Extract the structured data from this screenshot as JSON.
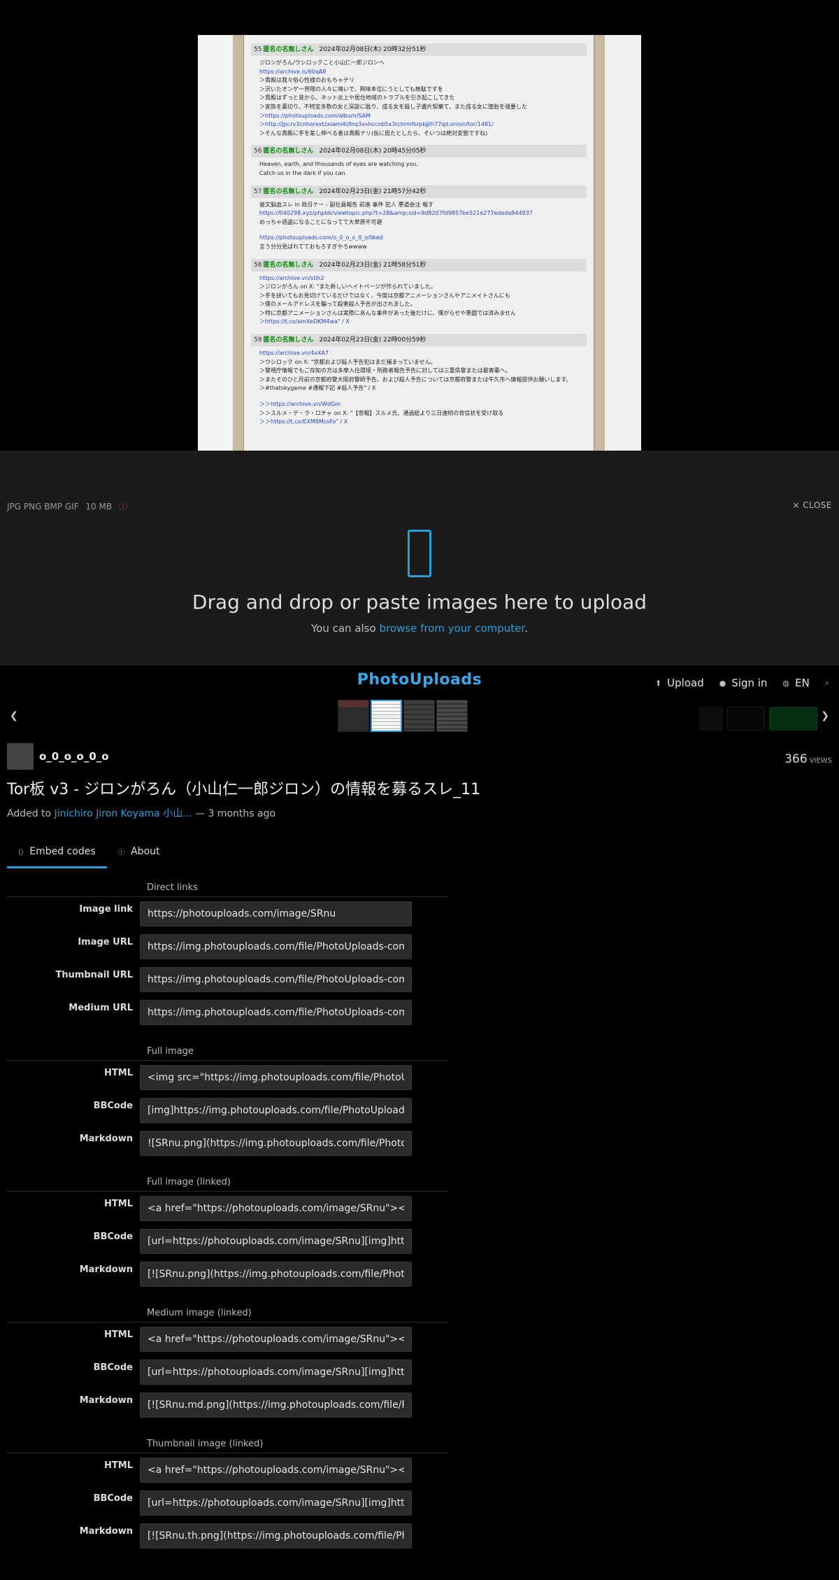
{
  "viewer": {
    "posts": [
      {
        "num": "55",
        "name": "匿名の名無しさん",
        "date": "2024年02月08日(木) 20時32分51秒",
        "lines": [
          {
            "t": "ジロンがろん/ウシロックこと小山仁一郎ジロンへ"
          },
          {
            "t": "https://archive.is/60qA8",
            "link": true
          },
          {
            "t": "＞貴殿は我々俗心性様のおもちゃテリ"
          },
          {
            "t": "＞沢いたオンゲー界隈の人々に嗅いで、興味本位にうとしても無駄ですを"
          },
          {
            "t": "＞貴殿はずっと昔から、ネット炎上や居住地域のトラブルを引き起こしてきた"
          },
          {
            "t": "＞家族を裏切り、不特定多数の女と深談に耽り、成る女を殺し子遺片契棄て、また成る女に堕胎を強要した"
          },
          {
            "t": "＞https://photouploads.com/album/SAM",
            "link": true
          },
          {
            "t": "＞http://jpcrv3cnhorxxtzxiami4ijfnq3xvhccob5x3rchrmfsrpbjjlh77qd.onion/tor/1481/",
            "link": true
          },
          {
            "t": "＞そんな貴殿に手を差し伸べる者は貴殿ナリ(仮に居たとしたら、そいつは絶対変態ですね)"
          }
        ]
      },
      {
        "num": "56",
        "name": "匿名の名無しさん",
        "date": "2024年02月08日(木) 20時45分05秒",
        "lines": [
          {
            "t": "Heaven, earth, and thousands of eyes are watching you."
          },
          {
            "t": "Catch us in the dark if you can."
          }
        ]
      },
      {
        "num": "57",
        "name": "匿名の名無しさん",
        "date": "2024年02月23日(金) 21時57分42秒",
        "lines": [
          {
            "t": "歯文脳血スレ in 政日ケー - 副社員報告 前進 事件 犯人 悪道会注 報す"
          },
          {
            "t": "https://040298.xyz/phpbb/viewtopic.php?t=28&amp;sid=9d8207fd9857be521e277ededa944937",
            "link": true
          },
          {
            "t": "めっちゃ逃盗になることになってて大草原不可避"
          },
          {
            "t": "",
            "gap": true
          },
          {
            "t": "https://photouploads.com/o_0_o_o_0_o/liked",
            "link": true
          },
          {
            "t": "言う分分見ばれてておもろすぎやろwwww"
          }
        ]
      },
      {
        "num": "58",
        "name": "匿名の名無しさん",
        "date": "2024年02月23日(金) 21時58分51秒",
        "lines": [
          {
            "t": "https://archive.vn/stih2",
            "link": true
          },
          {
            "t": "＞ジロンがろん on X: \"また新しいヘイトページが作られていました。"
          },
          {
            "t": "＞手を挟いてもお見切けているだけではなく、今度は京都アニメーションさんやアニメイトさんにも"
          },
          {
            "t": "＞僕のメールアドレスを騙って殺害殺人予告が出されました。"
          },
          {
            "t": "＞特に京都アニメーションさんは実際にあんな事件があった後だけに、僕がらせや悪戯では済みません"
          },
          {
            "t": "＞https://t.co/amXeDKM4wa\" / X",
            "link": true
          }
        ]
      },
      {
        "num": "59",
        "name": "匿名の名無しさん",
        "date": "2024年02月23日(金) 22時00分59秒",
        "lines": [
          {
            "t": "https://archive.vn/4xXA7",
            "link": true
          },
          {
            "t": "＞ウシロック on X: \"京都および殺人予告犯はまだ捕まっていません。"
          },
          {
            "t": "＞警視庁情報でもご存知の方は多摩入住環境・刑務者報告予告に対しては三重県警または最寄署へ。"
          },
          {
            "t": "＞またそのひと月前の京都府警大阪府警師予告、および殺人予告については京都府警または牛久市へ情報提供お願いします。"
          },
          {
            "t": "＞#thatskygame #通報下記 #殺人予告\" / X"
          },
          {
            "t": "",
            "gap": true
          },
          {
            "t": "＞＞https://archive.vn/WdGm",
            "link": true
          },
          {
            "t": "＞＞スルメ・デ・ラ・ロチャ on X: \"【悲報】スルメ氏、通過総より三日連続の背信状を受け取る"
          },
          {
            "t": "＞＞https://t.co/EXM8MssFo\" / X",
            "link": true
          }
        ]
      }
    ]
  },
  "dropzone": {
    "formats": "JPG PNG BMP GIF",
    "max_size": "10 MB",
    "info_icon": "info-icon",
    "close_label": "CLOSE",
    "title": "Drag and drop or paste images here to upload",
    "sub_prefix": "You can also ",
    "sub_link": "browse from your computer",
    "sub_suffix": "."
  },
  "header": {
    "logo": "PhotoUploads",
    "upload": "Upload",
    "signin": "Sign in",
    "lang": "EN"
  },
  "image": {
    "username": "o_0_o_o_0_o",
    "views_count": "366",
    "views_label": "VIEWS",
    "title": "Tor板 v3 - ジロンがろん（小山仁一郎ジロン）の情報を募るスレ_11",
    "added_prefix": "Added to ",
    "album": "Jinichiro Jiron Koyama 小山...",
    "added_suffix": " — 3 months ago"
  },
  "tabs": [
    {
      "label": "Embed codes"
    },
    {
      "label": "About"
    }
  ],
  "embed": {
    "direct": {
      "title": "Direct links",
      "rows": [
        {
          "label": "Image link",
          "value": "https://photouploads.com/image/SRnu"
        },
        {
          "label": "Image URL",
          "value": "https://img.photouploads.com/file/PhotoUploads-com/SRnu.png"
        },
        {
          "label": "Thumbnail URL",
          "value": "https://img.photouploads.com/file/PhotoUploads-com/SRnu.th.png"
        },
        {
          "label": "Medium URL",
          "value": "https://img.photouploads.com/file/PhotoUploads-com/SRnu.md.png"
        }
      ]
    },
    "full": {
      "title": "Full image",
      "rows": [
        {
          "label": "HTML",
          "value": "<img src=\"https://img.photouploads.com/file/PhotoUploads-com/SRnu.png\" alt=\"SRnu.png\" border=\"0\">"
        },
        {
          "label": "BBCode",
          "value": "[img]https://img.photouploads.com/file/PhotoUploads-com/SRnu.png[/img]"
        },
        {
          "label": "Markdown",
          "value": "![SRnu.png](https://img.photouploads.com/file/PhotoUploads-com/SRnu.png)"
        }
      ]
    },
    "full_linked": {
      "title": "Full image (linked)",
      "rows": [
        {
          "label": "HTML",
          "value": "<a href=\"https://photouploads.com/image/SRnu\"><img src=\"https://img.photouploads.com/file/PhotoUploads-com/SRnu.png\"></a>"
        },
        {
          "label": "BBCode",
          "value": "[url=https://photouploads.com/image/SRnu][img]https://img.photouploads.com/file/PhotoUploads-com/SRnu.png[/img][/url]"
        },
        {
          "label": "Markdown",
          "value": "[![SRnu.png](https://img.photouploads.com/file/PhotoUploads-com/SRnu.png)](https://photouploads.com/image/SRnu)"
        }
      ]
    },
    "medium_linked": {
      "title": "Medium image (linked)",
      "rows": [
        {
          "label": "HTML",
          "value": "<a href=\"https://photouploads.com/image/SRnu\"><img src=\"https://img.photouploads.com/file/PhotoUploads-com/SRnu.md.png\"></a>"
        },
        {
          "label": "BBCode",
          "value": "[url=https://photouploads.com/image/SRnu][img]https://img.photouploads.com/file/PhotoUploads-com/SRnu.md.png[/img][/url]"
        },
        {
          "label": "Markdown",
          "value": "[![SRnu.md.png](https://img.photouploads.com/file/PhotoUploads-com/SRnu.md.png)](https://photouploads.com/image/SRnu)"
        }
      ]
    },
    "thumb_linked": {
      "title": "Thumbnail image (linked)",
      "rows": [
        {
          "label": "HTML",
          "value": "<a href=\"https://photouploads.com/image/SRnu\"><img src=\"https://img.photouploads.com/file/PhotoUploads-com/SRnu.th.png\"></a>"
        },
        {
          "label": "BBCode",
          "value": "[url=https://photouploads.com/image/SRnu][img]https://img.photouploads.com/file/PhotoUploads-com/SRnu.th.png[/img][/url]"
        },
        {
          "label": "Markdown",
          "value": "[![SRnu.th.png](https://img.photouploads.com/file/PhotoUploads-com/SRnu.th.png)](https://photouploads.com/image/SRnu)"
        }
      ]
    }
  },
  "colors": {
    "accent": "#2a9ed8",
    "poster_name": "#0a8a0a",
    "link": "#2244cc"
  }
}
